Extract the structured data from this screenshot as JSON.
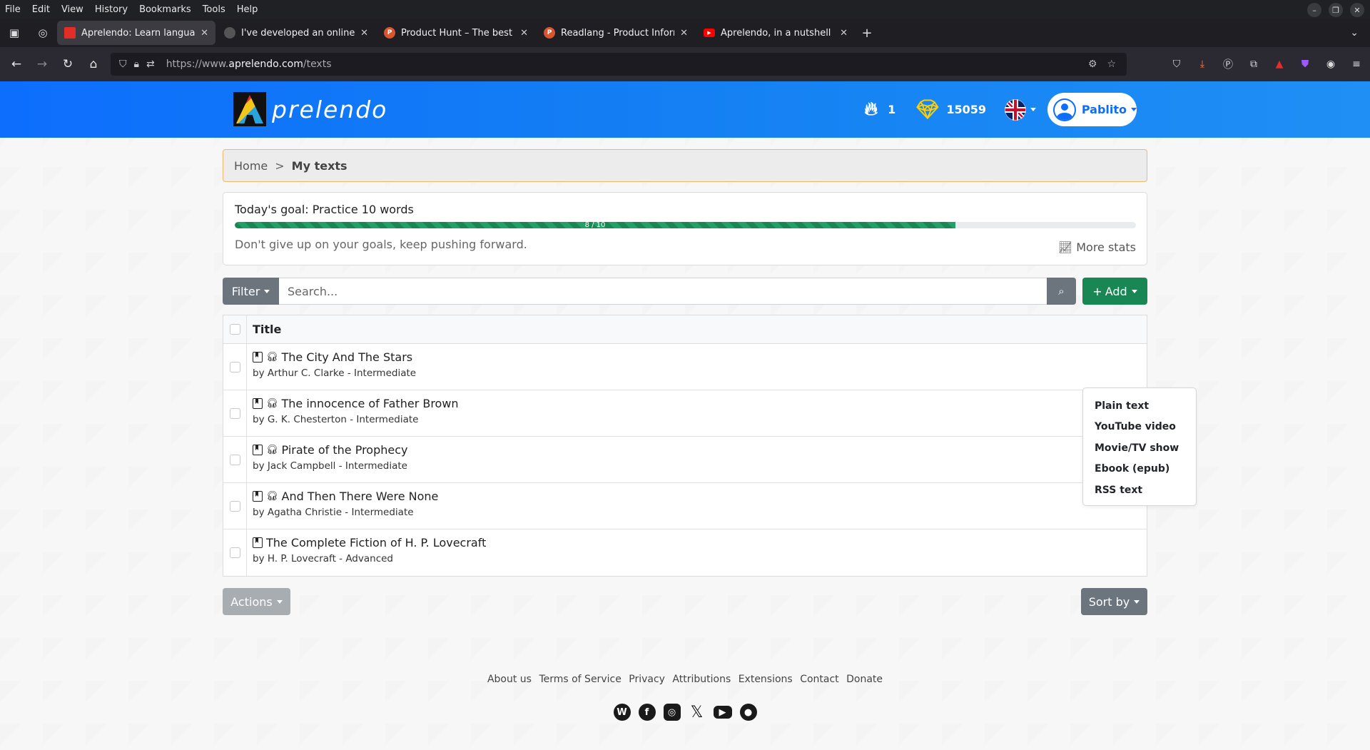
{
  "menubar": {
    "items": [
      "File",
      "Edit",
      "View",
      "History",
      "Bookmarks",
      "Tools",
      "Help"
    ]
  },
  "tabs": [
    {
      "title": "Aprelendo: Learn language",
      "favicon_color": "#222222",
      "favicon_text": ""
    },
    {
      "title": "I've developed an online lar",
      "favicon_color": "#444444",
      "favicon_text": ""
    },
    {
      "title": "Product Hunt – The best ne",
      "favicon_color": "#da552f",
      "favicon_text": "P"
    },
    {
      "title": "Readlang - Product Informa",
      "favicon_color": "#da552f",
      "favicon_text": "P"
    },
    {
      "title": "Aprelendo, in a nutshell - Yo",
      "favicon_color": "#ff0000",
      "favicon_text": "▶"
    }
  ],
  "url": {
    "prefix": "https://www.",
    "domain": "aprelendo.com",
    "path": "/texts"
  },
  "header": {
    "logo_text": "prelendo",
    "streak": "1",
    "gems": "15059",
    "username": "Pablito"
  },
  "breadcrumb": {
    "home": "Home",
    "separator": ">",
    "current": "My texts"
  },
  "goal": {
    "title": "Today's goal: Practice 10 words",
    "progress_label": "8 / 10",
    "progress_value": 0.8,
    "message": "Don't give up on your goals, keep pushing forward.",
    "more_stats": "More stats"
  },
  "search": {
    "filter_label": "Filter",
    "placeholder": "Search...",
    "add_label": "Add"
  },
  "add_menu": [
    "Plain text",
    "YouTube video",
    "Movie/TV show",
    "Ebook (epub)",
    "RSS text"
  ],
  "table": {
    "header": "Title",
    "rows": [
      {
        "title": "The City And The Stars",
        "byline": "by Arthur C. Clarke - Intermediate",
        "audio": true
      },
      {
        "title": "The innocence of Father Brown",
        "byline": "by G. K. Chesterton - Intermediate",
        "audio": true
      },
      {
        "title": "Pirate of the Prophecy",
        "byline": "by Jack Campbell - Intermediate",
        "audio": true
      },
      {
        "title": "And Then There Were None",
        "byline": "by Agatha Christie - Intermediate",
        "audio": true
      },
      {
        "title": "The Complete Fiction of H. P. Lovecraft",
        "byline": "by H. P. Lovecraft - Advanced",
        "audio": false
      }
    ]
  },
  "buttons": {
    "actions": "Actions",
    "sort_by": "Sort by"
  },
  "footer": {
    "links": [
      "About us",
      "Terms of Service",
      "Privacy",
      "Attributions",
      "Extensions",
      "Contact",
      "Donate"
    ],
    "socials": [
      "wordpress-icon",
      "facebook-icon",
      "instagram-icon",
      "x-icon",
      "youtube-icon",
      "github-icon"
    ]
  },
  "colors": {
    "header_blue": "#0d6efd",
    "add_green": "#198754",
    "progress_green": "#198754",
    "breadcrumb_border": "#f0b86b"
  }
}
